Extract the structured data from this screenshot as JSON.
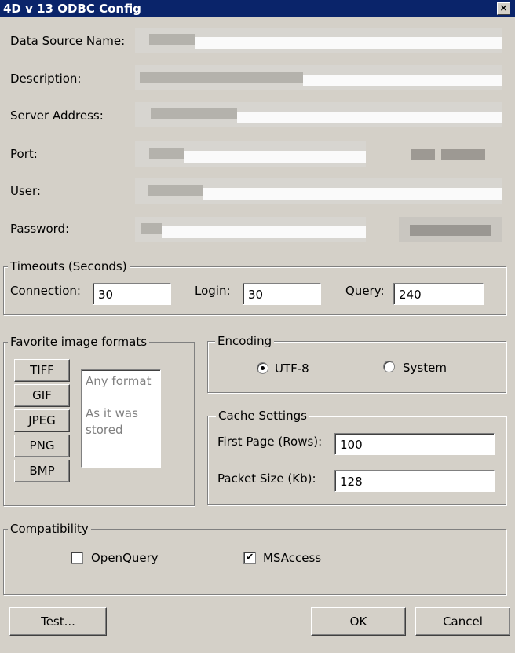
{
  "window": {
    "title": "4D v 13 ODBC Config",
    "close_glyph": "×"
  },
  "fields": {
    "dsn_label": "Data Source Name:",
    "description_label": "Description:",
    "server_label": "Server Address:",
    "port_label": "Port:",
    "user_label": "User:",
    "password_label": "Password:"
  },
  "timeouts": {
    "legend": "Timeouts (Seconds)",
    "connection_label": "Connection:",
    "connection_value": "30",
    "login_label": "Login:",
    "login_value": "30",
    "query_label": "Query:",
    "query_value": "240"
  },
  "image_formats": {
    "legend": "Favorite image formats",
    "buttons": [
      "TIFF",
      "GIF",
      "JPEG",
      "PNG",
      "BMP"
    ],
    "list": [
      "Any format",
      "As it was stored"
    ]
  },
  "encoding": {
    "legend": "Encoding",
    "utf8_label": "UTF-8",
    "system_label": "System",
    "selected": "UTF-8"
  },
  "cache": {
    "legend": "Cache Settings",
    "first_page_label": "First Page (Rows):",
    "first_page_value": "100",
    "packet_size_label": "Packet Size (Kb):",
    "packet_size_value": "128"
  },
  "compatibility": {
    "legend": "Compatibility",
    "openquery_label": "OpenQuery",
    "openquery_checked": false,
    "msaccess_label": "MSAccess",
    "msaccess_checked": true,
    "check_glyph": "✔"
  },
  "footer": {
    "test_label": "Test...",
    "ok_label": "OK",
    "cancel_label": "Cancel"
  },
  "colors": {
    "titlebar": "#0a246a",
    "dialog": "#d4d0c8"
  }
}
